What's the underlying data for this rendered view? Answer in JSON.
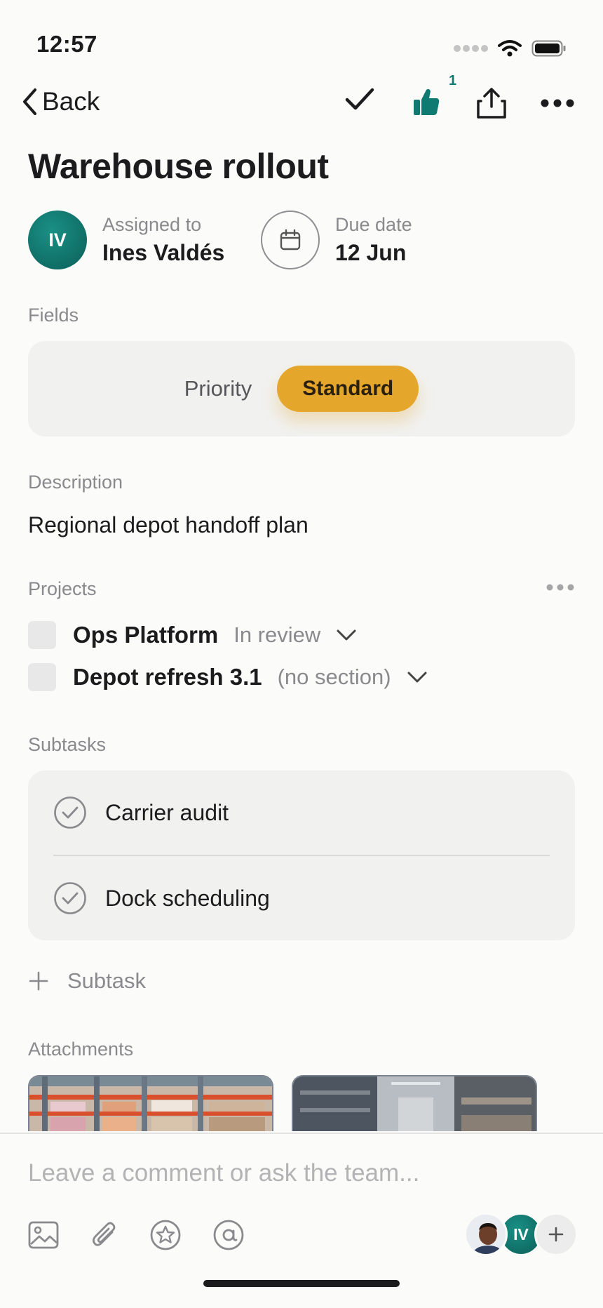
{
  "status_bar": {
    "time": "12:57"
  },
  "nav": {
    "back_label": "Back",
    "like_count": "1"
  },
  "task": {
    "title": "Warehouse rollout",
    "assignee": {
      "initials": "IV",
      "label": "Assigned to",
      "name": "Ines Valdés"
    },
    "due": {
      "label": "Due date",
      "value": "12 Jun"
    }
  },
  "fields": {
    "section_label": "Fields",
    "items": [
      {
        "name": "Priority",
        "value": "Standard",
        "value_color": "#e4a62b"
      }
    ]
  },
  "description": {
    "section_label": "Description",
    "text": "Regional depot handoff plan"
  },
  "projects": {
    "section_label": "Projects",
    "items": [
      {
        "name": "Ops Platform",
        "section": "In review"
      },
      {
        "name": "Depot refresh 3.1",
        "section": "(no section)"
      }
    ]
  },
  "subtasks": {
    "section_label": "Subtasks",
    "items": [
      {
        "title": "Carrier audit"
      },
      {
        "title": "Dock scheduling"
      }
    ],
    "add_label": "Subtask"
  },
  "attachments": {
    "section_label": "Attachments"
  },
  "composer": {
    "placeholder": "Leave a comment or ask the team...",
    "collaborator_initials": "IV"
  },
  "icons": [
    "back-chevron-icon",
    "check-icon",
    "thumbs-up-icon",
    "share-icon",
    "more-icon",
    "calendar-icon",
    "chevron-down-icon",
    "check-circle-icon",
    "plus-icon",
    "image-icon",
    "paperclip-icon",
    "star-icon",
    "mention-icon"
  ],
  "colors": {
    "accent": "#0f7a72",
    "priority_standard": "#e4a62b"
  }
}
